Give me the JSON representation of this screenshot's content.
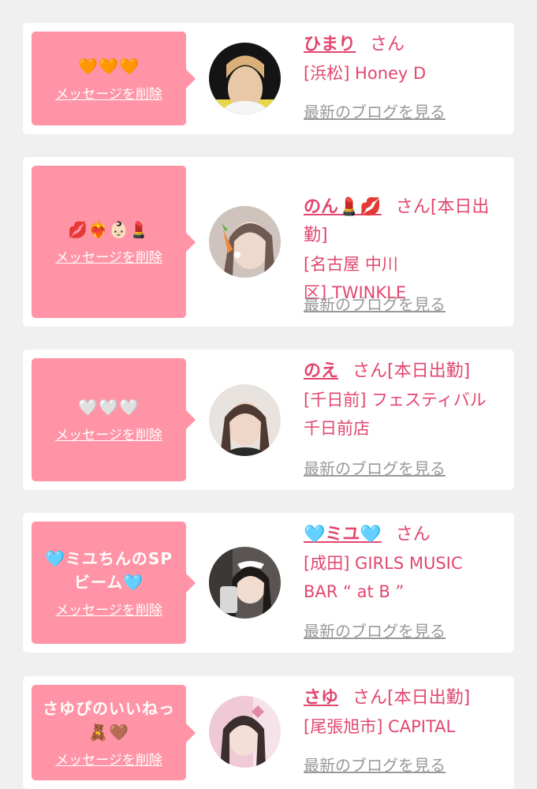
{
  "cards": [
    {
      "message": "🧡🧡🧡",
      "delete_label": "メッセージを削除",
      "name": "ひまり",
      "honorific": "さん",
      "status": "",
      "shop": "[浜松] Honey D",
      "blog_label": "最新のブログを見る"
    },
    {
      "message": "💋❤️‍🔥👶🏻💄",
      "delete_label": "メッセージを削除",
      "name": "のん💄💋",
      "honorific": "さん",
      "status": "[本日出\n勤]",
      "shop": "[名古屋 中川\n区] TWINKLE",
      "blog_label": "最新のブログを見る"
    },
    {
      "message": "🤍🤍🤍",
      "delete_label": "メッセージを削除",
      "name": "のえ",
      "honorific": "さん",
      "status": "[本日出勤]",
      "shop": "[千日前] フェスティバル\n千日前店",
      "blog_label": "最新のブログを見る"
    },
    {
      "message": "🩵ミユちんのSP\nビーム🩵",
      "delete_label": "メッセージを削除",
      "name": "🩵ミユ🩵",
      "honorific": "さん",
      "status": "",
      "shop": "[成田] GIRLS MUSIC\nBAR “ at B ”",
      "blog_label": "最新のブログを見る"
    },
    {
      "message": "さゆぴのいいねっ\n🧸🤎",
      "delete_label": "メッセージを削除",
      "name": "さゆ",
      "honorific": "さん",
      "status": "[本日出勤]",
      "shop": "[尾張旭市] CAPITAL",
      "blog_label": "最新のブログを見る"
    }
  ]
}
